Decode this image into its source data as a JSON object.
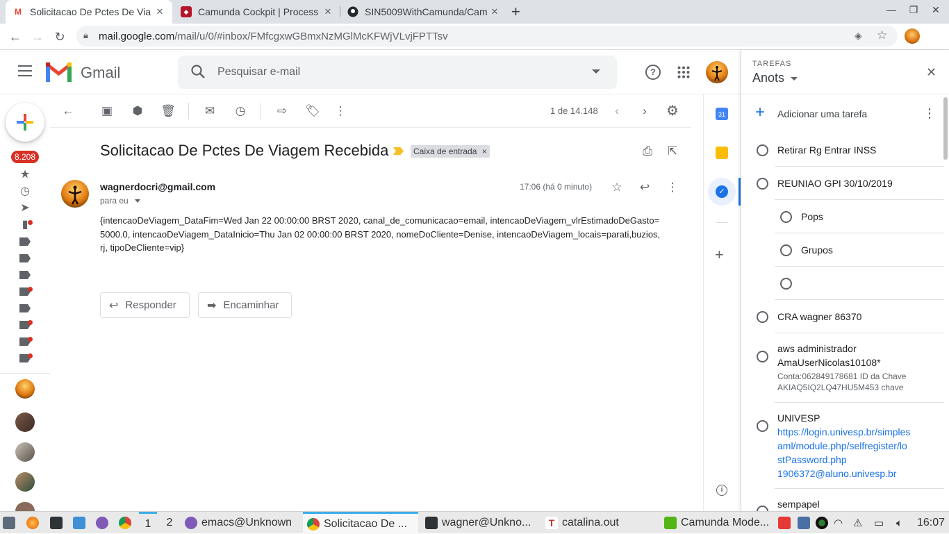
{
  "browser": {
    "tabs": [
      {
        "label": "Solicitacao De Pctes De Via",
        "active": true
      },
      {
        "label": "Camunda Cockpit | Process",
        "active": false
      },
      {
        "label": "SIN5009WithCamunda/Cam",
        "active": false
      }
    ],
    "new_tab": "+",
    "window_controls": {
      "minimize": "—",
      "restore": "❐",
      "close": "✕"
    },
    "url_host": "mail.google.com",
    "url_path": "/mail/u/0/#inbox/FMfcgxwGBmxNzMGlMcKFWjVLvjFPTTsv"
  },
  "gmail": {
    "app_name": "Gmail",
    "search_placeholder": "Pesquisar e-mail",
    "unread_badge": "8.208",
    "pagination": "1 de 14.148",
    "subject": "Solicitacao De Pctes De Viagem Recebida",
    "label_chip": "Caixa de entrada",
    "label_chip_close": "×",
    "sender": "wagnerdocri@gmail.com",
    "to_line": "para eu",
    "time": "17:06 (há 0 minuto)",
    "body": "{intencaoDeViagem_DataFim=Wed Jan 22 00:00:00 BRST 2020, canal_de_comunicacao=email, intencaoDeViagem_vlrEstimadoDeGasto=5000.0, intencaoDeViagem_DataInicio=Thu Jan 02 00:00:00 BRST 2020, nomeDoCliente=Denise, intencaoDeViagem_locais=parati,buzios,rj, tipoDeCliente=vip}",
    "reply_label": "Responder",
    "forward_label": "Encaminhar"
  },
  "tasks": {
    "kicker": "TAREFAS",
    "list_name": "Anots",
    "add_task": "Adicionar uma tarefa",
    "items": [
      {
        "title": "Retirar Rg Entrar INSS"
      },
      {
        "title": "REUNIAO GPI 30/10/2019"
      },
      {
        "title": "Pops"
      },
      {
        "title": "Grupos"
      },
      {
        "title": ""
      },
      {
        "title": "CRA wagner 86370"
      },
      {
        "title_line1": "aws administrador",
        "title_line2": "AmaUserNicolas10108*",
        "note_line1": "Conta:062849178681 ID da Chave",
        "note_line2": "AKIAQ5IQ2LQ47HU5M453 chave"
      },
      {
        "title": "UNIVESP",
        "link_line1": "https://login.univesp.br/simples",
        "link_line2": "aml/module.php/selfregister/lo",
        "link_line3": "stPassword.php",
        "link_line4": "1906372@aluno.univesp.br"
      },
      {
        "title": "sempapel"
      }
    ]
  },
  "taskbar": {
    "workspaces": [
      "1",
      "2"
    ],
    "windows": [
      "emacs@Unknown",
      "Solicitacao De ...",
      "wagner@Unkno...",
      "catalina.out",
      "Camunda Mode..."
    ],
    "clock": "16:07"
  },
  "colors": {
    "gmail_red": "#ea4335",
    "badge_red": "#d93025",
    "link_blue": "#1a73e8",
    "important_yellow": "#f6bf26"
  }
}
